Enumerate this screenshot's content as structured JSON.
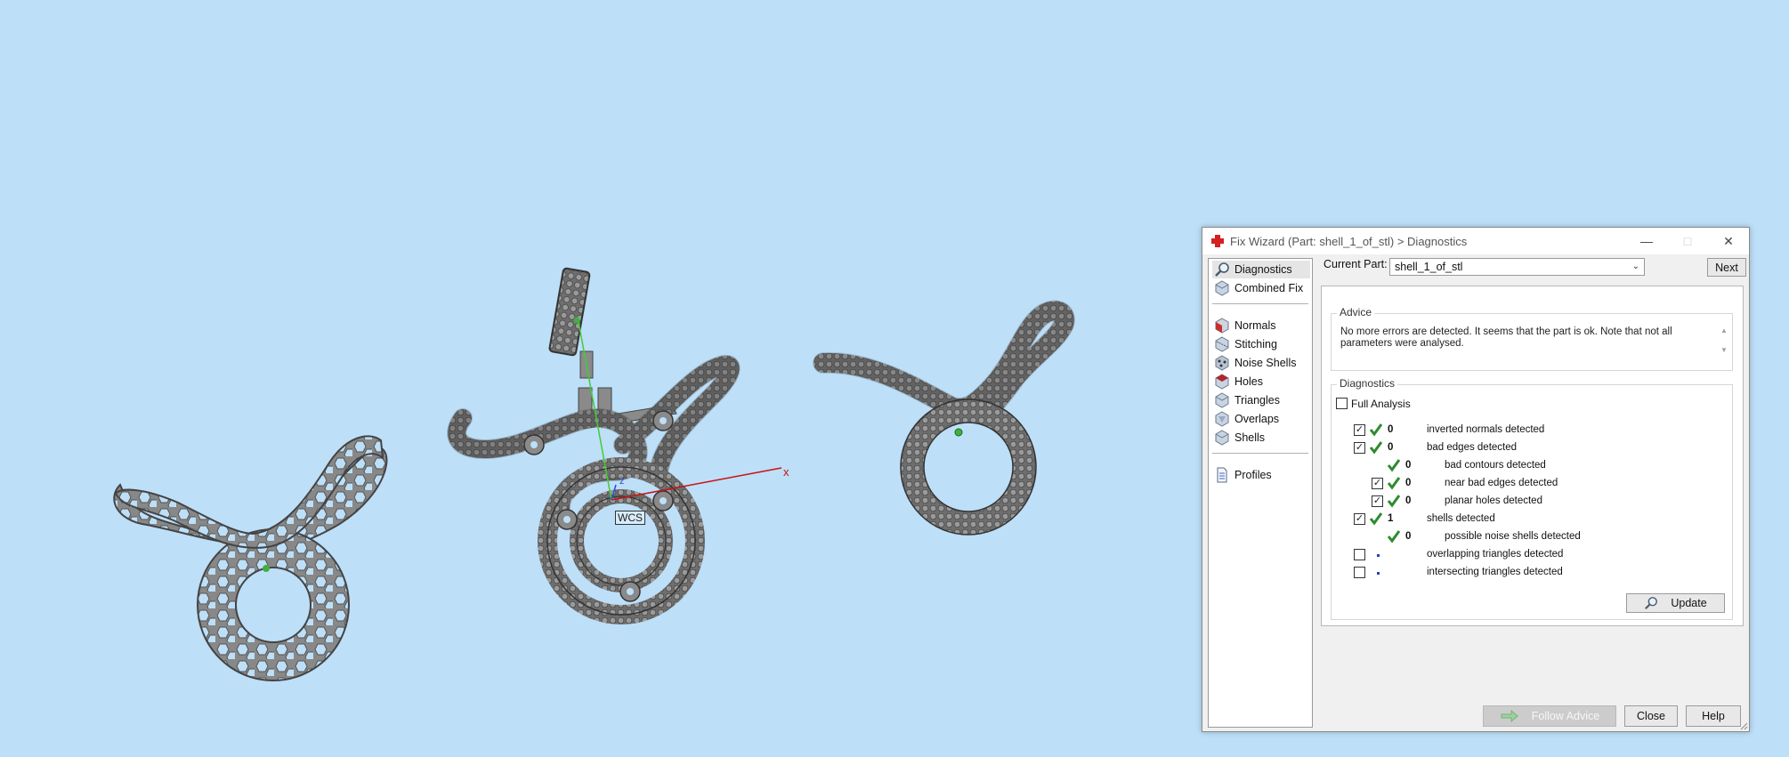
{
  "window": {
    "title": "Fix Wizard (Part: shell_1_of_stl) > Diagnostics",
    "minimize_icon": "minimize-icon",
    "maximize_icon": "maximize-icon",
    "close_icon": "close-icon"
  },
  "nav": {
    "items": [
      {
        "label": "Diagnostics",
        "icon": "magnifier-icon"
      },
      {
        "label": "Combined Fix",
        "icon": "cube-icon"
      },
      {
        "label": "Normals",
        "icon": "normals-cube-icon"
      },
      {
        "label": "Stitching",
        "icon": "stitching-cube-icon"
      },
      {
        "label": "Noise Shells",
        "icon": "noise-shells-icon"
      },
      {
        "label": "Holes",
        "icon": "holes-cube-icon"
      },
      {
        "label": "Triangles",
        "icon": "triangles-cube-icon"
      },
      {
        "label": "Overlaps",
        "icon": "overlaps-cube-icon"
      },
      {
        "label": "Shells",
        "icon": "shells-cube-icon"
      },
      {
        "label": "Profiles",
        "icon": "document-icon"
      }
    ]
  },
  "current_part": {
    "label": "Current Part:",
    "value": "shell_1_of_stl",
    "next_label": "Next"
  },
  "advice": {
    "title": "Advice",
    "text": "No more errors are detected. It seems that the part is ok. Note that not all parameters were analysed."
  },
  "diagnostics": {
    "title": "Diagnostics",
    "full_analysis_label": "Full Analysis",
    "full_analysis_checked": false,
    "rows": [
      {
        "checkbox": true,
        "checked": true,
        "status": "ok",
        "value": "0",
        "label": "inverted normals detected"
      },
      {
        "checkbox": true,
        "checked": true,
        "status": "ok",
        "value": "0",
        "label": "bad edges detected"
      },
      {
        "checkbox": false,
        "checked": false,
        "status": "ok",
        "value": "0",
        "label": "bad contours detected"
      },
      {
        "checkbox": true,
        "checked": true,
        "status": "ok",
        "value": "0",
        "label": "near bad edges detected"
      },
      {
        "checkbox": true,
        "checked": true,
        "status": "ok",
        "value": "0",
        "label": "planar holes detected"
      },
      {
        "checkbox": true,
        "checked": true,
        "status": "ok",
        "value": "1",
        "label": "shells detected"
      },
      {
        "checkbox": false,
        "checked": false,
        "status": "ok",
        "value": "0",
        "label": "possible noise shells detected"
      },
      {
        "checkbox": true,
        "checked": false,
        "status": "unset",
        "value": "",
        "label": "overlapping triangles detected"
      },
      {
        "checkbox": true,
        "checked": false,
        "status": "unset",
        "value": "",
        "label": "intersecting triangles detected"
      }
    ],
    "update_label": "Update"
  },
  "footer": {
    "follow_advice_label": "Follow Advice",
    "close_label": "Close",
    "help_label": "Help"
  },
  "viewport": {
    "axis_x_label": "x",
    "axis_z_label": "z",
    "wcs_label": "WCS",
    "background": "#bddff8",
    "part_color": "#8a8a8a"
  },
  "colors": {
    "ok_tick": "#2e8b2e",
    "unset_dot": "#2a3cc8",
    "app_icon": "#d42020"
  }
}
